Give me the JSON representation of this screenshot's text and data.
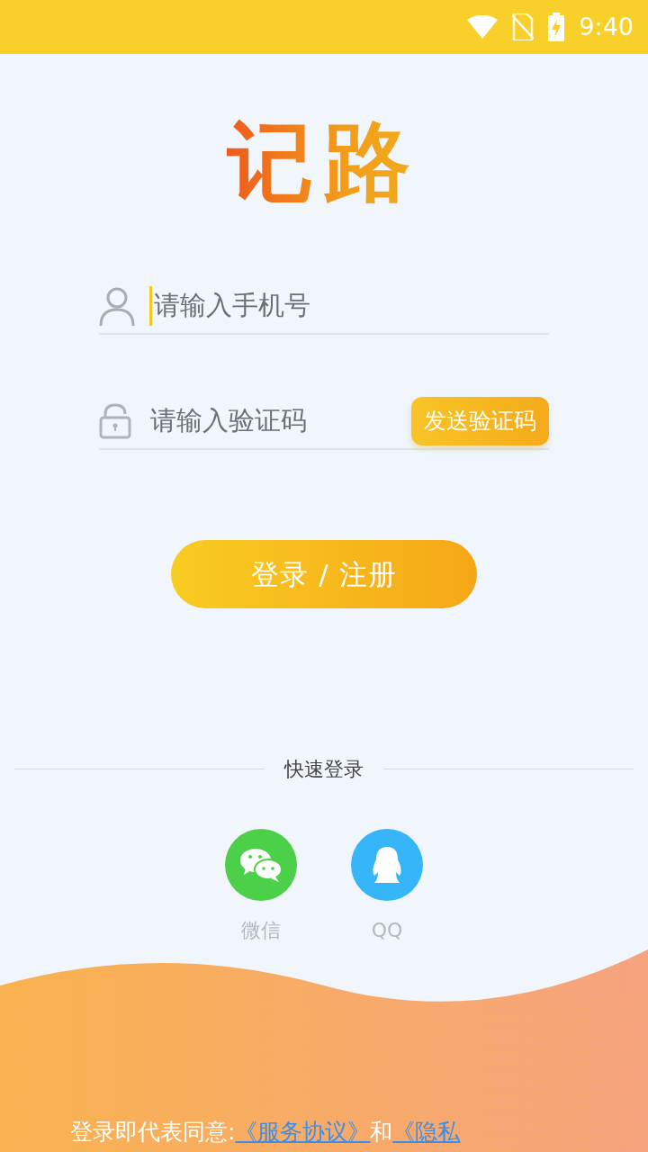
{
  "status_bar": {
    "time": "9:40"
  },
  "logo": {
    "title": "记路"
  },
  "fields": [
    {
      "kind": "phone",
      "placeholder": "请输入手机号",
      "focused": true
    },
    {
      "kind": "code",
      "placeholder": "请输入验证码",
      "focused": false,
      "action": "发送验证码"
    }
  ],
  "login_button": "登录 / 注册",
  "quick_login": {
    "label": "快速登录",
    "options": [
      {
        "kind": "wechat",
        "label": "微信",
        "color": "#4cd04a"
      },
      {
        "kind": "qq",
        "label": "QQ",
        "color": "#36b6f8"
      }
    ]
  },
  "footer": {
    "text": "登录即代表同意:",
    "links": [
      "《服务协议》",
      "《隐私"
    ],
    "joiner": "和"
  }
}
